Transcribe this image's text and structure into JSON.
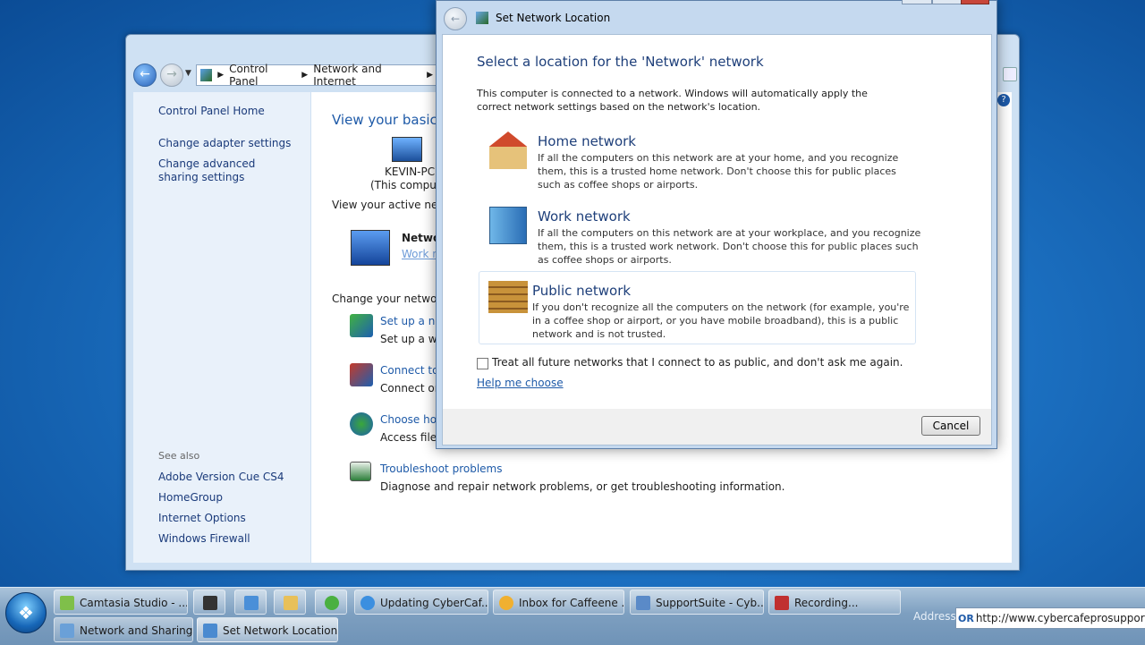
{
  "control_panel": {
    "breadcrumb": [
      "Control Panel",
      "Network and Internet"
    ],
    "left_links": [
      "Control Panel Home",
      "Change adapter settings",
      "Change advanced sharing settings"
    ],
    "see_also_label": "See also",
    "see_also": [
      "Adobe Version Cue CS4",
      "HomeGroup",
      "Internet Options",
      "Windows Firewall"
    ],
    "view_basic": "View your basic n",
    "computer_name": "KEVIN-PC",
    "computer_sub": "(This compute",
    "active_networks": "View your active netw",
    "network_name": "Netwo",
    "network_type_link": "Work n",
    "change_networking": "Change your networki",
    "tasks": [
      {
        "link": "Set up a new",
        "desc": "Set up a wir"
      },
      {
        "link": "Connect to",
        "desc": "Connect or"
      },
      {
        "link": "Choose hor",
        "desc": "Access files"
      },
      {
        "link": "Troubleshoot problems",
        "desc": "Diagnose and repair network problems, or get troubleshooting information."
      }
    ]
  },
  "dialog": {
    "title": "Set Network Location",
    "heading": "Select a location for the 'Network' network",
    "intro": "This computer is connected to a network. Windows will automatically apply the correct network settings based on the network's location.",
    "options": [
      {
        "title": "Home network",
        "desc": "If all the computers on this network are at your home, and you recognize them, this is a trusted home network.  Don't choose this for public places such as coffee shops or airports."
      },
      {
        "title": "Work network",
        "desc": "If all the computers on this network are at your workplace, and you recognize them, this is a trusted work network.  Don't choose this for public places such as coffee shops or airports."
      },
      {
        "title": "Public network",
        "desc": "If you don't recognize all the computers on the network (for example, you're in a coffee shop or airport, or you have mobile broadband), this is a public network and is not trusted."
      }
    ],
    "checkbox_label": "Treat all future networks that I connect to as public, and don't ask me again.",
    "help_link": "Help me choose",
    "cancel": "Cancel"
  },
  "taskbar": {
    "row1": [
      "Camtasia Studio - ...",
      "Updating CyberCaf...",
      "Inbox for Caffeene ...",
      "SupportSuite - Cyb...",
      "Recording..."
    ],
    "row2": [
      "Network and Sharing...",
      "Set Network Location"
    ],
    "address_label": "Address",
    "address_value": "http://www.cybercafeprosupport.co"
  }
}
